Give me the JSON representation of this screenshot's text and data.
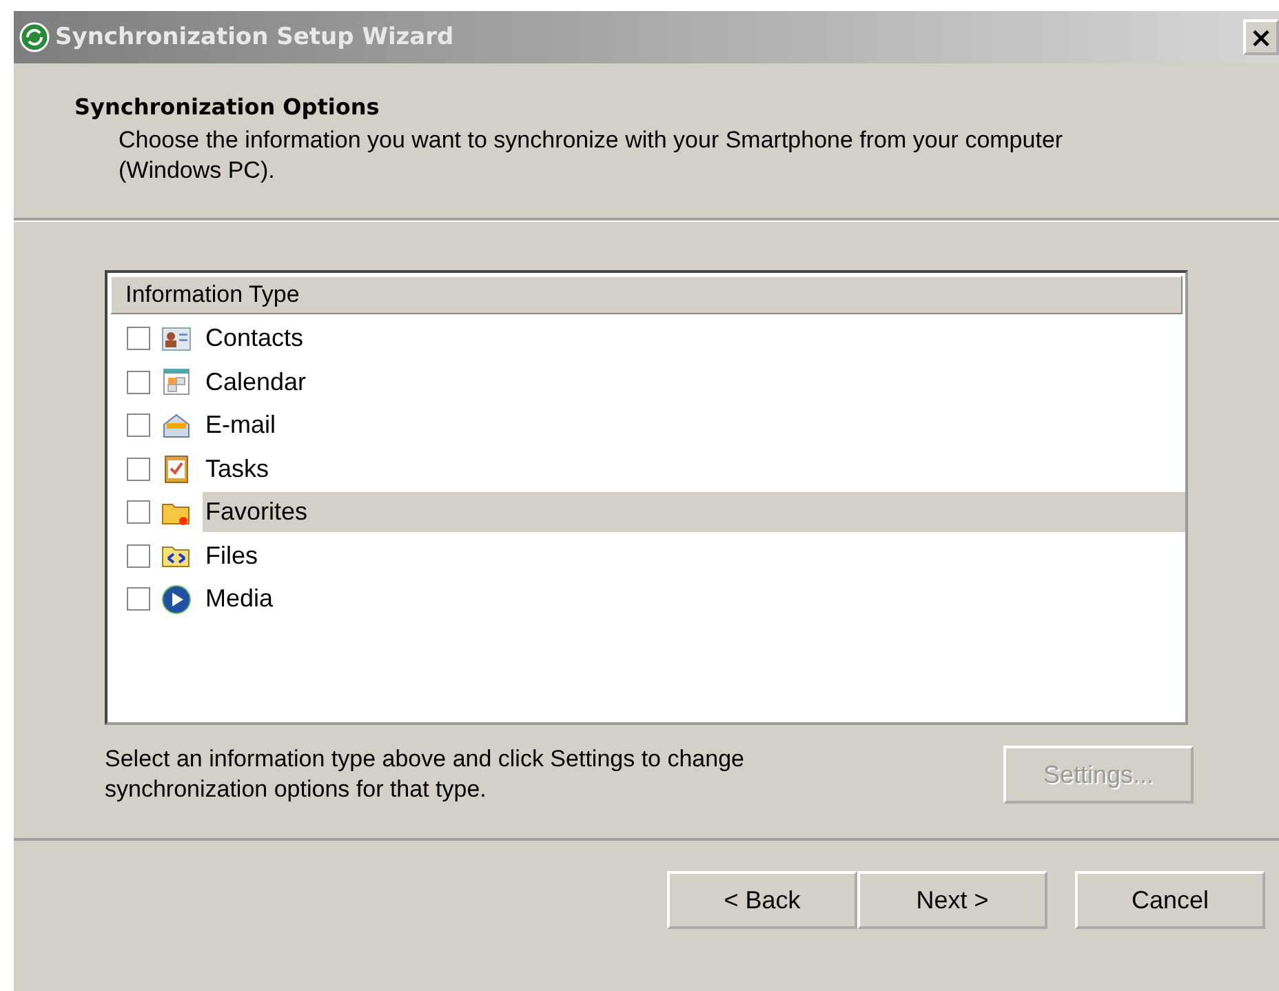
{
  "window": {
    "title": "Synchronization Setup Wizard",
    "close_label": "×"
  },
  "header": {
    "title": "Synchronization Options",
    "description": "Choose the information you want to synchronize with your Smartphone from your computer (Windows PC)."
  },
  "list": {
    "column": "Information Type",
    "items": [
      {
        "label": "Contacts",
        "checked": false,
        "selected": false
      },
      {
        "label": "Calendar",
        "checked": false,
        "selected": false
      },
      {
        "label": "E-mail",
        "checked": false,
        "selected": false
      },
      {
        "label": "Tasks",
        "checked": false,
        "selected": false
      },
      {
        "label": "Favorites",
        "checked": false,
        "selected": true
      },
      {
        "label": "Files",
        "checked": false,
        "selected": false
      },
      {
        "label": "Media",
        "checked": false,
        "selected": false
      }
    ]
  },
  "hint": "Select an information type above and click Settings to change synchronization options for that type.",
  "settings_button": {
    "label": "Settings...",
    "disabled": true
  },
  "buttons": [
    {
      "label": "< Back"
    },
    {
      "label": "Next >"
    },
    {
      "label": "Cancel"
    }
  ]
}
